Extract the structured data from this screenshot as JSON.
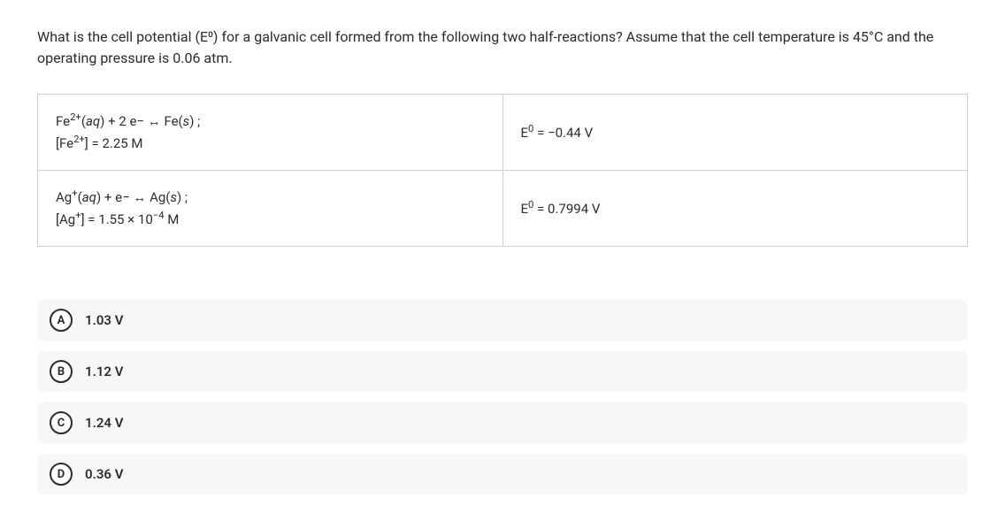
{
  "question": {
    "prompt": "What is the cell potential (E⁰) for a galvanic cell formed from the following two half-reactions? Assume that the cell temperature is 45°C and the operating pressure is 0.06 atm."
  },
  "reactions": {
    "row1": {
      "reaction_html": "Fe<sup>2+</sup>(<em>aq</em>) + 2 e− <span class=\"dblarrow\">↔</span> Fe(<em>s</em>) ;<br>[Fe<sup>2+</sup>] = 2.25 M",
      "potential_html": "E<sup>0</sup> = −0.44 V"
    },
    "row2": {
      "reaction_html": "Ag<sup>+</sup>(<em>aq</em>) + e− <span class=\"dblarrow\">↔</span> Ag(<em>s</em>) ;<br>[Ag<sup>+</sup>] = 1.55 × 10<sup>−4</sup> M",
      "potential_html": "E<sup>0</sup> = 0.7994 V"
    }
  },
  "options": {
    "a": {
      "letter": "A",
      "text": "1.03 V"
    },
    "b": {
      "letter": "B",
      "text": "1.12 V"
    },
    "c": {
      "letter": "C",
      "text": "1.24 V"
    },
    "d": {
      "letter": "D",
      "text": "0.36 V"
    }
  }
}
